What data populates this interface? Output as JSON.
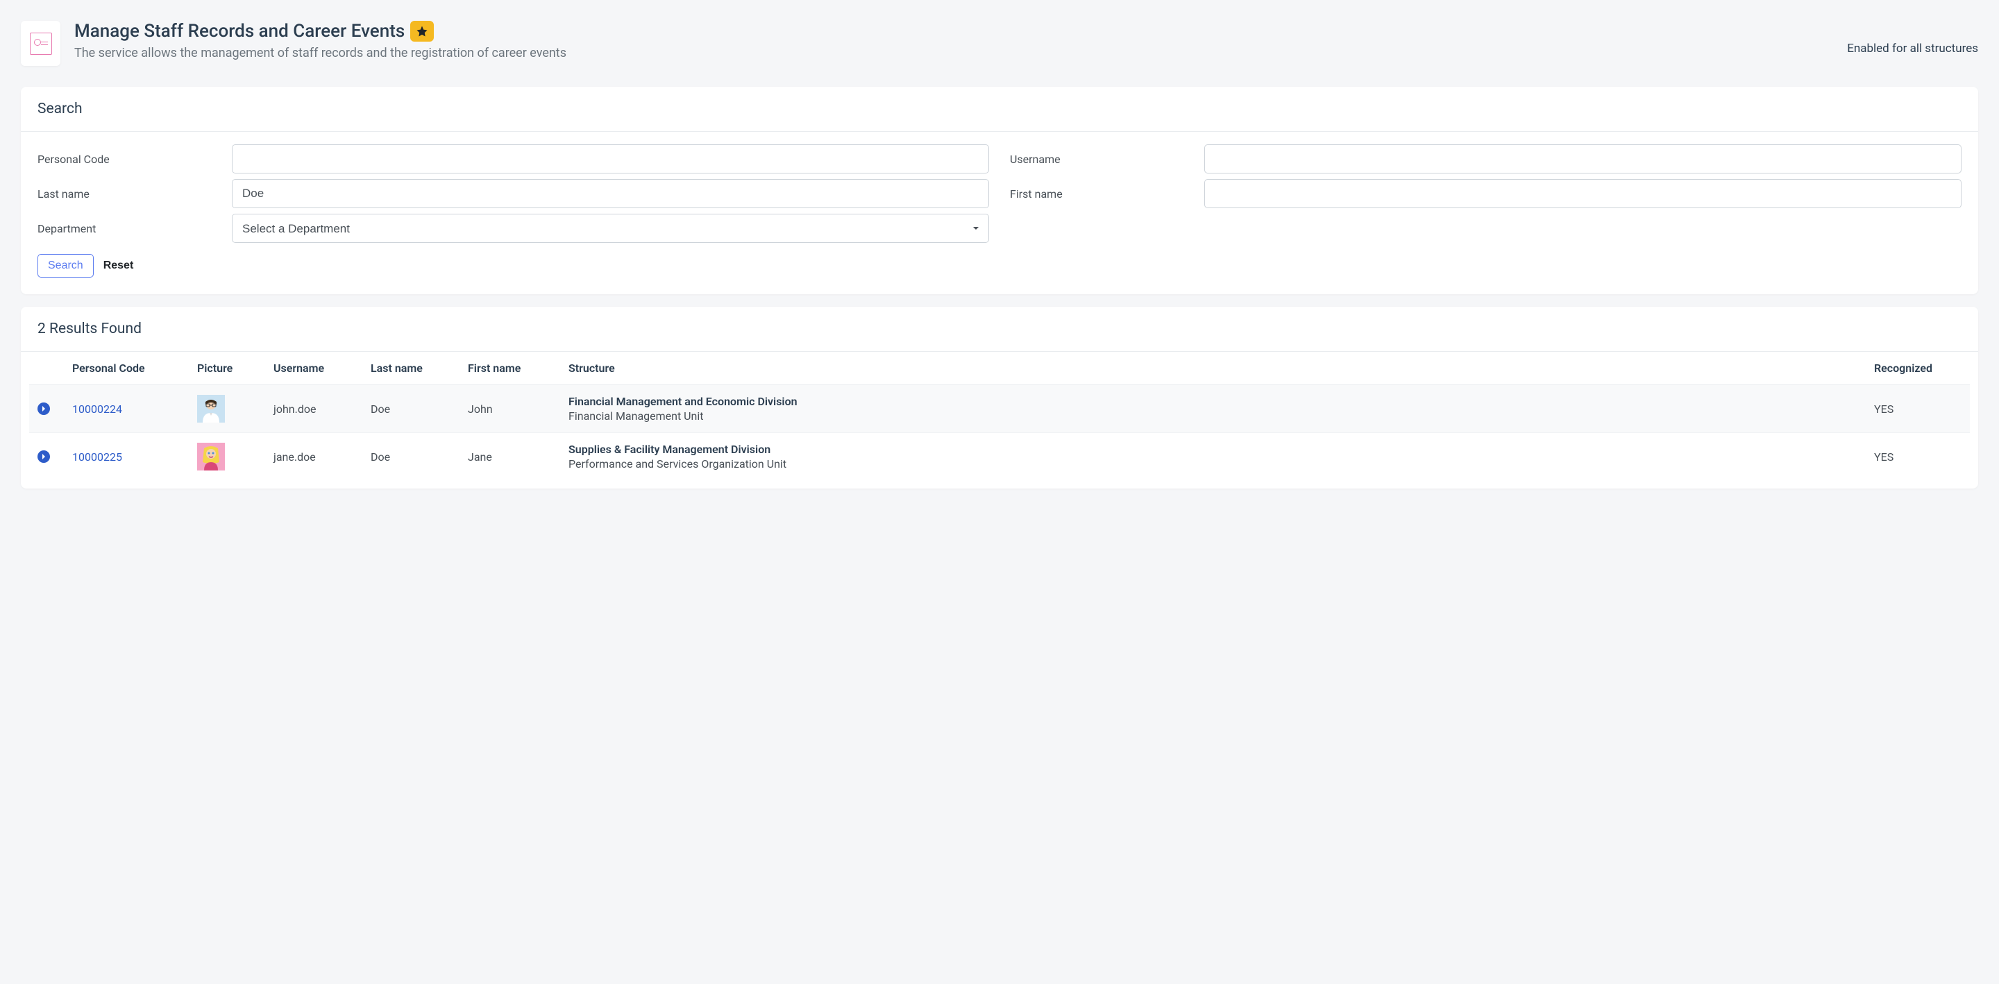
{
  "header": {
    "title": "Manage Staff Records and Career Events",
    "subtitle": "The service allows the management of staff records and the registration of career events",
    "scope_label": "Enabled for all structures"
  },
  "search": {
    "card_title": "Search",
    "fields": {
      "personal_code": {
        "label": "Personal Code",
        "value": ""
      },
      "username": {
        "label": "Username",
        "value": ""
      },
      "last_name": {
        "label": "Last name",
        "value": "Doe"
      },
      "first_name": {
        "label": "First name",
        "value": ""
      },
      "department": {
        "label": "Department",
        "placeholder": "Select a Department"
      }
    },
    "buttons": {
      "search": "Search",
      "reset": "Reset"
    }
  },
  "results": {
    "title": "2 Results Found",
    "columns": {
      "personal_code": "Personal Code",
      "picture": "Picture",
      "username": "Username",
      "last_name": "Last name",
      "first_name": "First name",
      "structure": "Structure",
      "recognized": "Recognized"
    },
    "rows": [
      {
        "personal_code": "10000224",
        "username": "john.doe",
        "last_name": "Doe",
        "first_name": "John",
        "structure_main": "Financial Management and Economic Division",
        "structure_sub": "Financial Management Unit",
        "recognized": "YES"
      },
      {
        "personal_code": "10000225",
        "username": "jane.doe",
        "last_name": "Doe",
        "first_name": "Jane",
        "structure_main": "Supplies & Facility Management Division",
        "structure_sub": "Performance and Services Organization Unit",
        "recognized": "YES"
      }
    ]
  }
}
